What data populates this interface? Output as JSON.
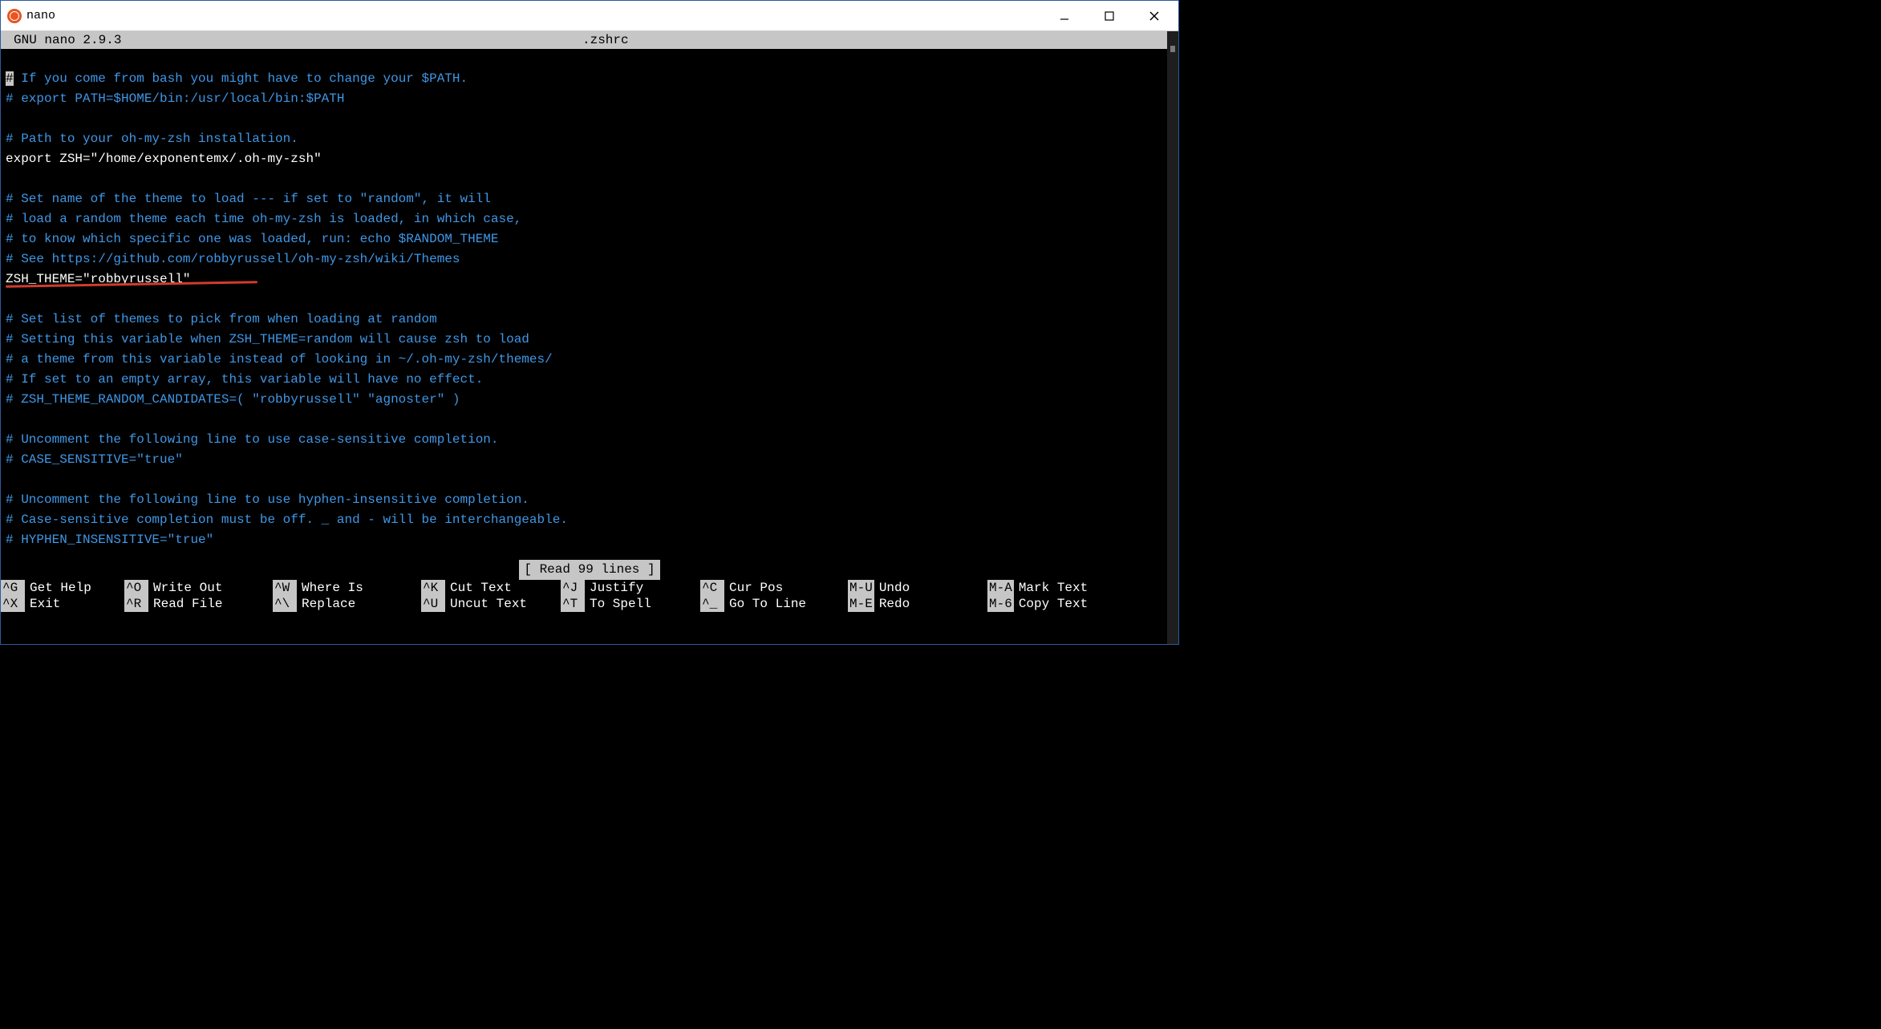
{
  "window": {
    "title": "nano"
  },
  "header": {
    "app": "  GNU nano 2.9.3",
    "filename": ".zshrc"
  },
  "lines": [
    {
      "type": "comment",
      "text": "# If you come from bash you might have to change your $PATH.",
      "cursor_first": true
    },
    {
      "type": "comment",
      "text": "# export PATH=$HOME/bin:/usr/local/bin:$PATH"
    },
    {
      "type": "blank"
    },
    {
      "type": "comment",
      "text": "# Path to your oh-my-zsh installation."
    },
    {
      "type": "code",
      "text": "export ZSH=\"/home/exponentemx/.oh-my-zsh\""
    },
    {
      "type": "blank"
    },
    {
      "type": "comment",
      "text": "# Set name of the theme to load --- if set to \"random\", it will"
    },
    {
      "type": "comment",
      "text": "# load a random theme each time oh-my-zsh is loaded, in which case,"
    },
    {
      "type": "comment",
      "text": "# to know which specific one was loaded, run: echo $RANDOM_THEME"
    },
    {
      "type": "comment",
      "text": "# See https://github.com/robbyrussell/oh-my-zsh/wiki/Themes"
    },
    {
      "type": "code",
      "text": "ZSH_THEME=\"robbyrussell\""
    },
    {
      "type": "blank"
    },
    {
      "type": "comment",
      "text": "# Set list of themes to pick from when loading at random"
    },
    {
      "type": "comment",
      "text": "# Setting this variable when ZSH_THEME=random will cause zsh to load"
    },
    {
      "type": "comment",
      "text": "# a theme from this variable instead of looking in ~/.oh-my-zsh/themes/"
    },
    {
      "type": "comment",
      "text": "# If set to an empty array, this variable will have no effect."
    },
    {
      "type": "comment",
      "text": "# ZSH_THEME_RANDOM_CANDIDATES=( \"robbyrussell\" \"agnoster\" )"
    },
    {
      "type": "blank"
    },
    {
      "type": "comment",
      "text": "# Uncomment the following line to use case-sensitive completion."
    },
    {
      "type": "comment",
      "text": "# CASE_SENSITIVE=\"true\""
    },
    {
      "type": "blank"
    },
    {
      "type": "comment",
      "text": "# Uncomment the following line to use hyphen-insensitive completion."
    },
    {
      "type": "comment",
      "text": "# Case-sensitive completion must be off. _ and - will be interchangeable."
    },
    {
      "type": "comment",
      "text": "# HYPHEN_INSENSITIVE=\"true\""
    }
  ],
  "status": "[ Read 99 lines ]",
  "shortcuts": {
    "row1": [
      {
        "key": "^G",
        "label": "Get Help"
      },
      {
        "key": "^O",
        "label": "Write Out"
      },
      {
        "key": "^W",
        "label": "Where Is"
      },
      {
        "key": "^K",
        "label": "Cut Text"
      },
      {
        "key": "^J",
        "label": "Justify"
      },
      {
        "key": "^C",
        "label": "Cur Pos"
      },
      {
        "key": "M-U",
        "label": "Undo"
      },
      {
        "key": "M-A",
        "label": "Mark Text"
      }
    ],
    "row2": [
      {
        "key": "^X",
        "label": "Exit"
      },
      {
        "key": "^R",
        "label": "Read File"
      },
      {
        "key": "^\\",
        "label": "Replace"
      },
      {
        "key": "^U",
        "label": "Uncut Text"
      },
      {
        "key": "^T",
        "label": "To Spell"
      },
      {
        "key": "^_",
        "label": "Go To Line"
      },
      {
        "key": "M-E",
        "label": "Redo"
      },
      {
        "key": "M-6",
        "label": "Copy Text"
      }
    ]
  }
}
